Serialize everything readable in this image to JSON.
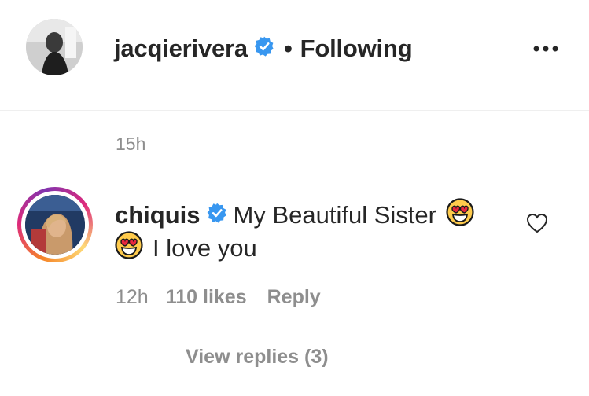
{
  "post": {
    "username": "jacqierivera",
    "separator": "•",
    "follow_status": "Following",
    "time": "15h"
  },
  "comment": {
    "username": "chiquis",
    "text_part1": "My Beautiful Sister",
    "text_part2": "I love you",
    "time": "12h",
    "likes": "110 likes",
    "reply_label": "Reply",
    "view_replies": "View replies (3)"
  },
  "icons": {
    "verified": "verified-badge-icon",
    "more": "more-options-icon",
    "heart": "heart-outline-icon",
    "emoji": "heart-eyes-emoji-icon"
  },
  "colors": {
    "verified_blue": "#3897f0",
    "muted_text": "#8e8e8e",
    "primary_text": "#262626"
  }
}
